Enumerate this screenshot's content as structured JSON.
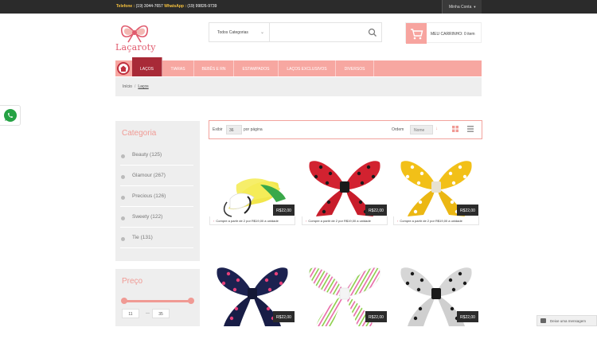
{
  "topbar": {
    "phone_label": "Telefone :",
    "phone": "(19) 3044-7657",
    "whatsapp_label": "WhatsApp :",
    "whatsapp": "(19) 99826-9739",
    "account": "Minha Conta"
  },
  "brand": {
    "name": "Laçaroty"
  },
  "search": {
    "category": "Todos Categorias",
    "query": ""
  },
  "cart": {
    "label": "MEU CARRINHO: 0 item"
  },
  "nav": {
    "items": [
      "LAÇOS",
      "TIARAS",
      "BEBÊS E RN",
      "ESTAMPADOS",
      "LAÇOS EXCLUSIVOS",
      "DIVERSOS"
    ]
  },
  "breadcrumb": {
    "home": "Início",
    "sep": "/",
    "current": "Laços"
  },
  "sidebar": {
    "title": "Categoria",
    "categories": [
      "Beauty (125)",
      "Glamour (267)",
      "Precious (126)",
      "Sweety (122)",
      "Tie (131)"
    ],
    "price_title": "Preço",
    "price_min": "11",
    "price_max": "35",
    "price_sep": "—"
  },
  "toolbar": {
    "show_label": "Exibir",
    "show_value": "36",
    "per_page": "por página",
    "order_label": "Ordem",
    "order_value": "Nome"
  },
  "products": [
    {
      "price": "R$22,00",
      "promo": "Compre a partir de 2 por R$19,00 a unidade"
    },
    {
      "price": "R$22,00",
      "promo": "Compre a partir de 2 por R$19,00 a unidade"
    },
    {
      "price": "R$22,00",
      "promo": "Compre a partir de 2 por R$19,00 a unidade"
    },
    {
      "price": "R$22,00"
    },
    {
      "price": "R$22,00"
    },
    {
      "price": "R$22,00"
    }
  ],
  "chat": {
    "label": "Deixe uma mensagem"
  },
  "colors": {
    "accent": "#f7a7a1",
    "active_nav": "#a82a37",
    "brand": "#e05a6d"
  }
}
